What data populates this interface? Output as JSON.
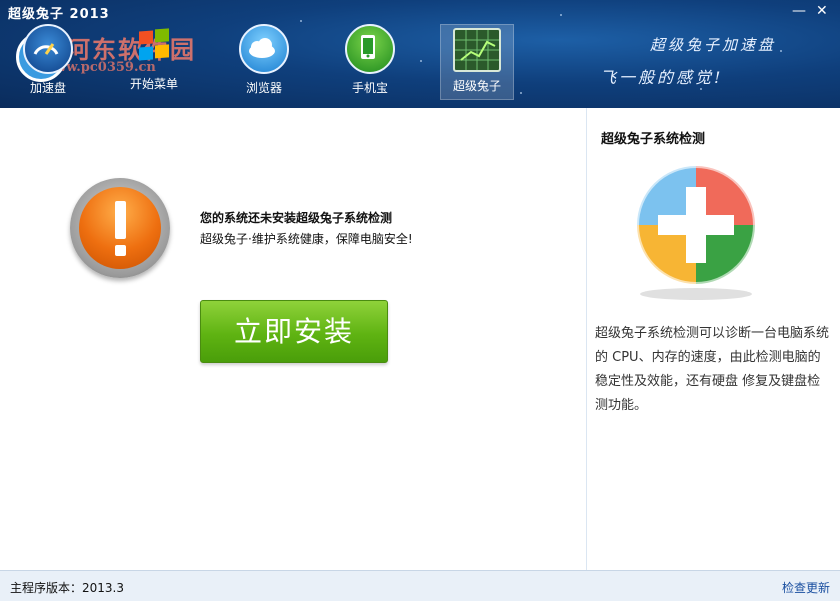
{
  "window": {
    "title": "超级兔子 2013",
    "minimize_glyph": "—",
    "close_glyph": "✕"
  },
  "watermark": {
    "text": "河东软件园",
    "url": "www.pc0359.cn"
  },
  "nav": {
    "items": [
      {
        "label": "加速盘",
        "icon": "speed-gauge-icon"
      },
      {
        "label": "开始菜单",
        "icon": "windows-logo-icon"
      },
      {
        "label": "浏览器",
        "icon": "cloud-icon"
      },
      {
        "label": "手机宝",
        "icon": "phone-icon"
      },
      {
        "label": "超级兔子",
        "icon": "system-check-icon",
        "active": true
      }
    ]
  },
  "slogan": {
    "line1": "超级兔子加速盘",
    "line2": "飞一般的感觉!"
  },
  "main": {
    "message_title": "您的系统还未安装超级兔子系统检测",
    "message_sub": "超级兔子·维护系统健康，保障电脑安全!",
    "install_label": "立即安装"
  },
  "side": {
    "title": "超级兔子系统检测",
    "description": "超级兔子系统检测可以诊断一台电脑系统的 CPU、内存的速度，由此检测电脑的稳定性及效能，还有硬盘 修复及键盘检测功能。"
  },
  "status": {
    "version_label": "主程序版本：",
    "version_value": "2013.3",
    "update_label": "检查更新"
  },
  "colors": {
    "header_bg": "#0f3f7c",
    "install_green": "#5fb312",
    "warn_orange": "#ee6f10",
    "link_blue": "#1a4fa0"
  }
}
